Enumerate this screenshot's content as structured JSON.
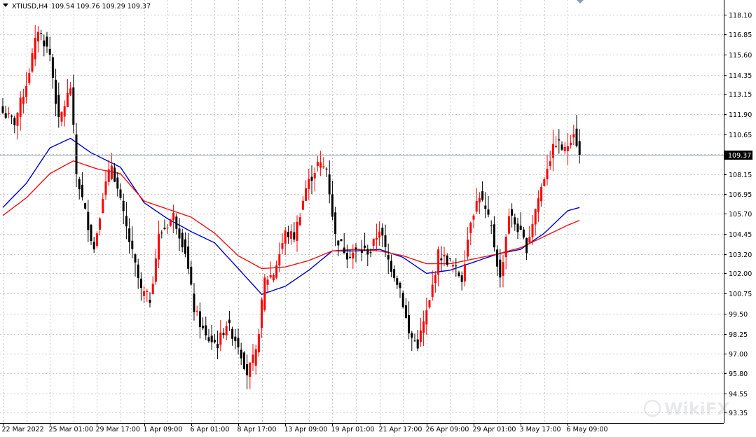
{
  "header": {
    "symbol_timeframe": "XTIUSD,H4",
    "ohlc_text": "109.54 109.76 109.29 109.37",
    "collapse_icon": "triangle-down-icon"
  },
  "watermark": {
    "text": "WikiFX",
    "icon": "wikifx-logo-icon"
  },
  "colors": {
    "background": "#ffffff",
    "grid": "#c8c8c8",
    "bull_candle": "#ff0000",
    "bear_candle": "#000000",
    "ma_fast": "#0000cc",
    "ma_slow": "#ee1111",
    "price_line": "#8c9cb0",
    "price_label_bg": "#000000",
    "price_label_text": "#ffffff"
  },
  "chart_data": {
    "type": "candlestick",
    "title": "XTIUSD,H4",
    "ylim": [
      92.7,
      119.0
    ],
    "y_ticks": [
      "118.10",
      "116.85",
      "115.60",
      "114.35",
      "113.15",
      "111.90",
      "110.65",
      "109.40",
      "108.15",
      "106.95",
      "105.70",
      "104.45",
      "103.20",
      "102.00",
      "100.75",
      "99.50",
      "98.25",
      "97.00",
      "95.80",
      "94.55",
      "93.35"
    ],
    "x_ticks": [
      "22 Mar 2022",
      "25 Mar 01:00",
      "29 Mar 17:00",
      "1 Apr 09:00",
      "6 Apr 01:00",
      "8 Apr 17:00",
      "13 Apr 09:00",
      "19 Apr 01:00",
      "21 Apr 17:00",
      "26 Apr 09:00",
      "29 Apr 01:00",
      "3 May 17:00",
      "6 May 09:00"
    ],
    "x_tick_bar_index": [
      0,
      16,
      32,
      48,
      64,
      80,
      96,
      112,
      128,
      144,
      160,
      176,
      192
    ],
    "last_price": 109.37,
    "last_price_label": "109.37",
    "bar_count": 197,
    "candles_approx_path": [
      [
        0,
        112.0
      ],
      [
        4,
        111.4
      ],
      [
        8,
        113.8
      ],
      [
        12,
        117.2
      ],
      [
        16,
        115.6
      ],
      [
        19,
        111.4
      ],
      [
        23,
        113.6
      ],
      [
        25,
        108.2
      ],
      [
        28,
        105.8
      ],
      [
        31,
        103.5
      ],
      [
        34,
        106.9
      ],
      [
        37,
        108.8
      ],
      [
        40,
        106.4
      ],
      [
        43,
        104.0
      ],
      [
        47,
        100.9
      ],
      [
        50,
        100.4
      ],
      [
        53,
        104.3
      ],
      [
        58,
        105.6
      ],
      [
        62,
        103.4
      ],
      [
        65,
        99.8
      ],
      [
        69,
        98.0
      ],
      [
        73,
        97.6
      ],
      [
        76,
        98.9
      ],
      [
        80,
        97.6
      ],
      [
        83,
        95.8
      ],
      [
        86,
        97.0
      ],
      [
        89,
        101.6
      ],
      [
        92,
        102.0
      ],
      [
        96,
        104.5
      ],
      [
        99,
        104.3
      ],
      [
        103,
        107.3
      ],
      [
        107,
        108.8
      ],
      [
        110,
        108.5
      ],
      [
        113,
        104.3
      ],
      [
        117,
        103.2
      ],
      [
        121,
        103.4
      ],
      [
        125,
        103.4
      ],
      [
        128,
        104.8
      ],
      [
        131,
        102.8
      ],
      [
        135,
        101.1
      ],
      [
        138,
        98.2
      ],
      [
        141,
        97.6
      ],
      [
        145,
        100.2
      ],
      [
        148,
        103.2
      ],
      [
        152,
        102.7
      ],
      [
        156,
        101.7
      ],
      [
        159,
        105.4
      ],
      [
        162,
        106.9
      ],
      [
        166,
        104.8
      ],
      [
        169,
        101.6
      ],
      [
        172,
        105.7
      ],
      [
        175,
        104.8
      ],
      [
        178,
        103.6
      ],
      [
        181,
        106.0
      ],
      [
        185,
        108.7
      ],
      [
        188,
        110.2
      ],
      [
        191,
        109.6
      ],
      [
        194,
        110.9
      ],
      [
        196,
        109.37
      ]
    ],
    "series": [
      {
        "type": "moving-average",
        "color_key": "ma_fast",
        "points": [
          [
            0,
            106.1
          ],
          [
            8,
            107.6
          ],
          [
            16,
            109.8
          ],
          [
            23,
            110.4
          ],
          [
            30,
            109.5
          ],
          [
            40,
            108.6
          ],
          [
            48,
            106.4
          ],
          [
            56,
            105.4
          ],
          [
            64,
            104.6
          ],
          [
            72,
            103.9
          ],
          [
            80,
            102.3
          ],
          [
            88,
            100.7
          ],
          [
            96,
            101.2
          ],
          [
            104,
            102.2
          ],
          [
            112,
            103.4
          ],
          [
            120,
            103.4
          ],
          [
            128,
            103.5
          ],
          [
            136,
            103.0
          ],
          [
            144,
            102.0
          ],
          [
            152,
            102.2
          ],
          [
            160,
            102.7
          ],
          [
            168,
            103.2
          ],
          [
            176,
            103.5
          ],
          [
            184,
            104.5
          ],
          [
            192,
            105.9
          ],
          [
            196,
            106.1
          ]
        ]
      },
      {
        "type": "moving-average",
        "color_key": "ma_slow",
        "points": [
          [
            0,
            105.6
          ],
          [
            8,
            106.7
          ],
          [
            16,
            108.2
          ],
          [
            24,
            109.0
          ],
          [
            32,
            108.5
          ],
          [
            40,
            108.2
          ],
          [
            48,
            106.5
          ],
          [
            56,
            106.0
          ],
          [
            64,
            105.5
          ],
          [
            72,
            104.5
          ],
          [
            80,
            103.1
          ],
          [
            88,
            102.3
          ],
          [
            96,
            102.4
          ],
          [
            104,
            102.8
          ],
          [
            112,
            103.4
          ],
          [
            120,
            103.5
          ],
          [
            128,
            103.4
          ],
          [
            136,
            103.1
          ],
          [
            144,
            102.6
          ],
          [
            152,
            102.6
          ],
          [
            160,
            102.9
          ],
          [
            168,
            103.2
          ],
          [
            176,
            103.6
          ],
          [
            184,
            104.3
          ],
          [
            192,
            105.0
          ],
          [
            196,
            105.3
          ]
        ]
      }
    ]
  }
}
